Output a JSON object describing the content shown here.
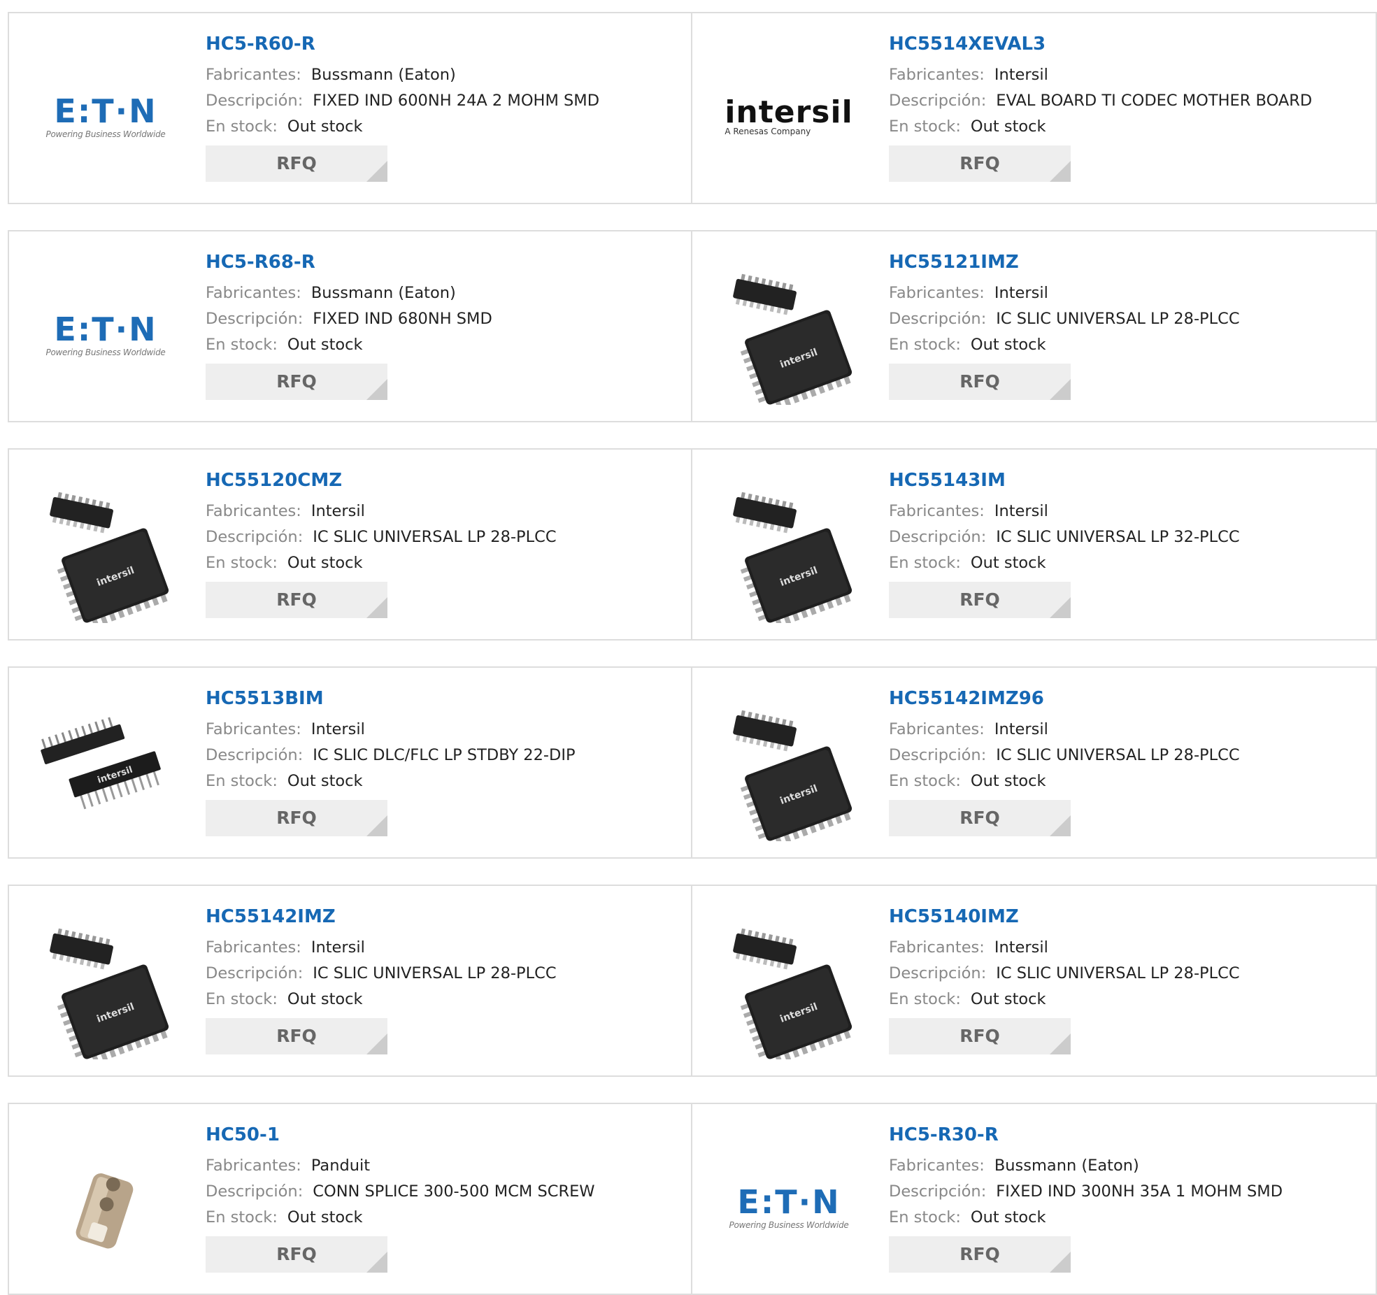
{
  "labels": {
    "manufacturer": "Fabricantes:",
    "description": "Descripción:",
    "stock": "En stock:"
  },
  "products": [
    {
      "part": "HC5-R60-R",
      "manufacturer": "Bussmann (Eaton)",
      "description": "FIXED IND 600NH 24A 2 MOHM SMD",
      "stock": "Out stock",
      "button": "RFQ",
      "image": "eaton-logo"
    },
    {
      "part": "HC5514XEVAL3",
      "manufacturer": "Intersil",
      "description": "EVAL BOARD TI CODEC MOTHER BOARD",
      "stock": "Out stock",
      "button": "RFQ",
      "image": "intersil-logo"
    },
    {
      "part": "HC5-R68-R",
      "manufacturer": "Bussmann (Eaton)",
      "description": "FIXED IND 680NH SMD",
      "stock": "Out stock",
      "button": "RFQ",
      "image": "eaton-logo"
    },
    {
      "part": "HC55121IMZ",
      "manufacturer": "Intersil",
      "description": "IC SLIC UNIVERSAL LP 28-PLCC",
      "stock": "Out stock",
      "button": "RFQ",
      "image": "plcc-chip"
    },
    {
      "part": "HC55120CMZ",
      "manufacturer": "Intersil",
      "description": "IC SLIC UNIVERSAL LP 28-PLCC",
      "stock": "Out stock",
      "button": "RFQ",
      "image": "plcc-chip"
    },
    {
      "part": "HC55143IM",
      "manufacturer": "Intersil",
      "description": "IC SLIC UNIVERSAL LP 32-PLCC",
      "stock": "Out stock",
      "button": "RFQ",
      "image": "plcc-chip"
    },
    {
      "part": "HC5513BIM",
      "manufacturer": "Intersil",
      "description": "IC SLIC DLC/FLC LP STDBY 22-DIP",
      "stock": "Out stock",
      "button": "RFQ",
      "image": "dip-chip"
    },
    {
      "part": "HC55142IMZ96",
      "manufacturer": "Intersil",
      "description": "IC SLIC UNIVERSAL LP 28-PLCC",
      "stock": "Out stock",
      "button": "RFQ",
      "image": "plcc-chip"
    },
    {
      "part": "HC55142IMZ",
      "manufacturer": "Intersil",
      "description": "IC SLIC UNIVERSAL LP 28-PLCC",
      "stock": "Out stock",
      "button": "RFQ",
      "image": "plcc-chip"
    },
    {
      "part": "HC55140IMZ",
      "manufacturer": "Intersil",
      "description": "IC SLIC UNIVERSAL LP 28-PLCC",
      "stock": "Out stock",
      "button": "RFQ",
      "image": "plcc-chip"
    },
    {
      "part": "HC50-1",
      "manufacturer": "Panduit",
      "description": "CONN SPLICE 300-500 MCM SCREW",
      "stock": "Out stock",
      "button": "RFQ",
      "image": "splice-connector"
    },
    {
      "part": "HC5-R30-R",
      "manufacturer": "Bussmann (Eaton)",
      "description": "FIXED IND 300NH 35A 1 MOHM SMD",
      "stock": "Out stock",
      "button": "RFQ",
      "image": "eaton-logo"
    }
  ],
  "logos": {
    "eaton_word": "E:T·N",
    "eaton_tagline": "Powering Business Worldwide",
    "intersil_word": "intersil",
    "intersil_tagline": "A Renesas Company",
    "chip_marking": "intersil"
  },
  "colors": {
    "part_link": "#1668b4",
    "label": "#888888",
    "value": "#222222",
    "button_bg": "#eeeeee",
    "button_text": "#666666",
    "border": "#dddddd",
    "eaton_blue": "#1e6cb6"
  }
}
